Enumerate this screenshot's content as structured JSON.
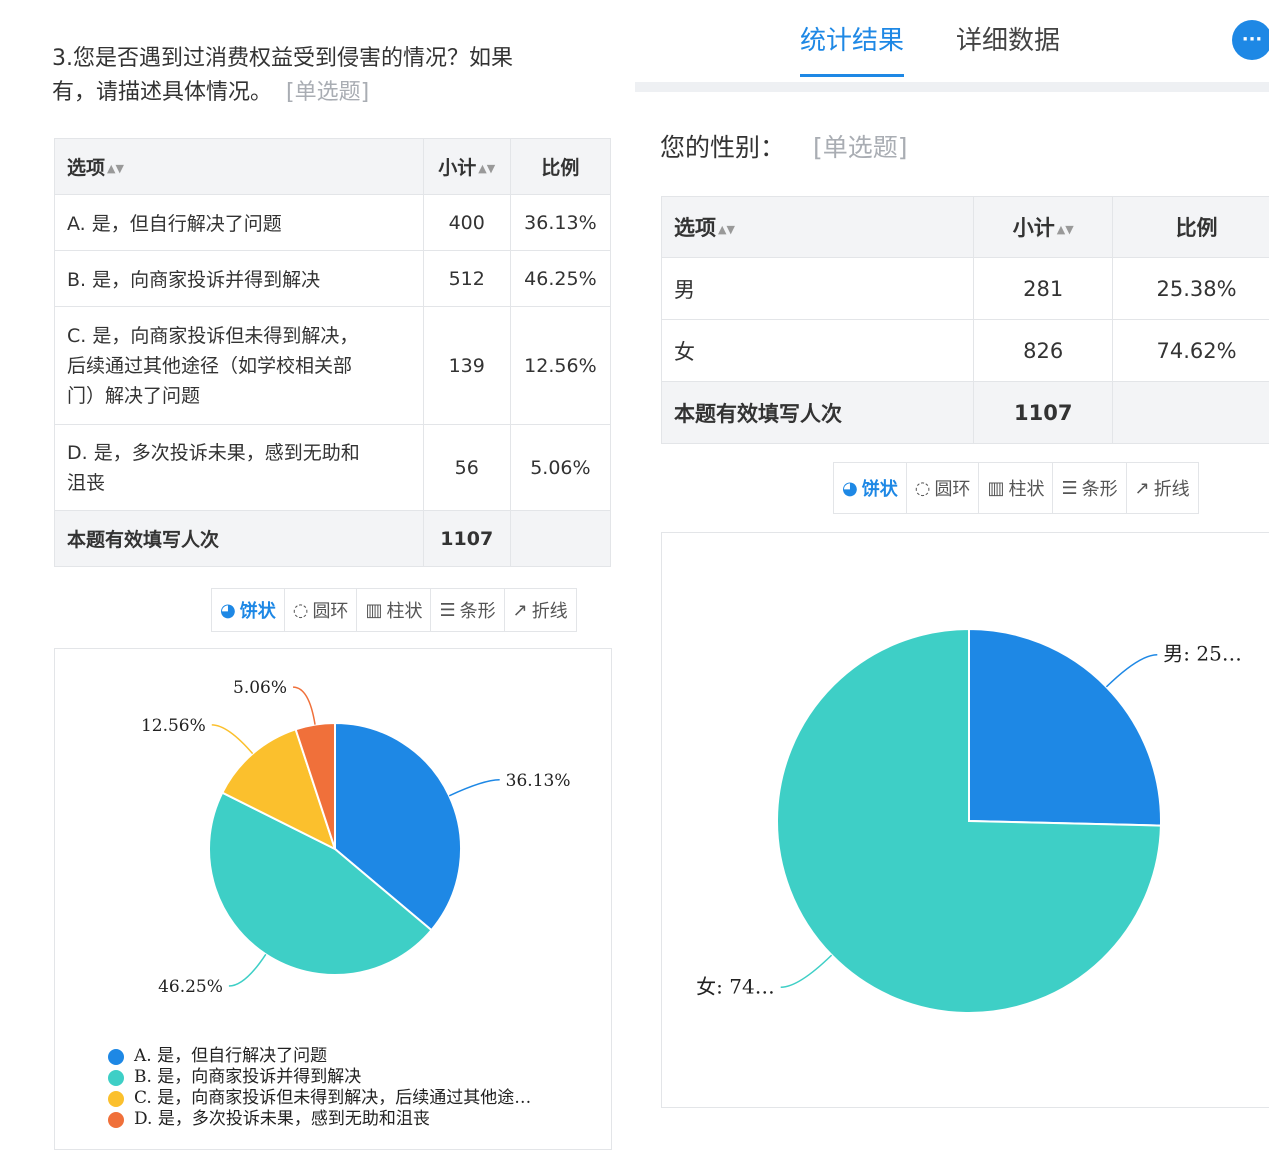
{
  "left": {
    "question": "3.您是否遇到过消费权益受到侵害的情况？如果有，请描述具体情况。",
    "question_line1": "3.您是否遇到过消费权益受到侵害的情况？如果",
    "question_line2": "有，请描述具体情况。",
    "type_tag": "[单选题]",
    "table": {
      "headers": [
        "选项",
        "小计",
        "比例"
      ],
      "rows": [
        {
          "option": "A. 是，但自行解决了问题",
          "count": "400",
          "ratio": "36.13%"
        },
        {
          "option": "B. 是，向商家投诉并得到解决",
          "count": "512",
          "ratio": "46.25%"
        },
        {
          "option_lines": [
            "C. 是，向商家投诉但未得到解决，",
            "后续通过其他途径（如学校相关部",
            "门）解决了问题"
          ],
          "count": "139",
          "ratio": "12.56%"
        },
        {
          "option_lines": [
            "D. 是，多次投诉未果，感到无助和",
            "沮丧"
          ],
          "count": "56",
          "ratio": "5.06%"
        }
      ],
      "total_label": "本题有效填写人次",
      "total_count": "1107"
    },
    "chart_buttons": [
      "饼状",
      "圆环",
      "柱状",
      "条形",
      "折线"
    ],
    "legend": [
      "A. 是，但自行解决了问题",
      "B. 是，向商家投诉并得到解决",
      "C. 是，向商家投诉但未得到解决，后续通过其他途…",
      "D. 是，多次投诉未果，感到无助和沮丧"
    ]
  },
  "right": {
    "tabs": [
      "统计结果",
      "详细数据"
    ],
    "more_icon": "ellipsis-icon",
    "question": "您的性别：",
    "type_tag": "[单选题]",
    "table": {
      "headers": [
        "选项",
        "小计",
        "比例"
      ],
      "rows": [
        {
          "option": "男",
          "count": "281",
          "ratio": "25.38%"
        },
        {
          "option": "女",
          "count": "826",
          "ratio": "74.62%"
        }
      ],
      "total_label": "本题有效填写人次",
      "total_count": "1107"
    },
    "chart_buttons": [
      "饼状",
      "圆环",
      "柱状",
      "条形",
      "折线"
    ]
  },
  "colors": {
    "blue": "#1e88e5",
    "teal": "#3ecfc6",
    "yellow": "#fbc02d",
    "orange": "#f0703a",
    "active": "#1e88e5"
  },
  "chart_data": [
    {
      "type": "pie",
      "categories": [
        "A. 是，但自行解决了问题",
        "B. 是，向商家投诉并得到解决",
        "C. 是，向商家投诉但未得到解决，后续通过其他途…",
        "D. 是，多次投诉未果，感到无助和沮丧"
      ],
      "values": [
        36.13,
        46.25,
        12.56,
        5.06
      ],
      "labels": [
        "36.13%",
        "46.25%",
        "12.56%",
        "5.06%"
      ],
      "legend": "bottom"
    },
    {
      "type": "pie",
      "categories": [
        "男",
        "女"
      ],
      "values": [
        25.38,
        74.62
      ],
      "labels": [
        "男: 25…",
        "女: 74…"
      ],
      "legend": "none"
    }
  ]
}
